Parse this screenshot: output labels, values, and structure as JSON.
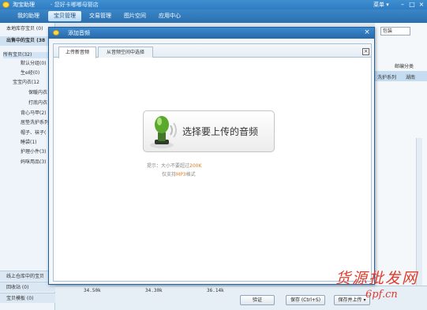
{
  "app": {
    "title": "淘宝助理",
    "shop": "- 您好卡嘟嘟母婴店",
    "user": "菜单 ▾",
    "window_buttons": [
      "–",
      "□",
      "×"
    ]
  },
  "nav": {
    "tabs": [
      {
        "label": "我的助理"
      },
      {
        "label": "宝贝管理"
      },
      {
        "label": "交易管理"
      },
      {
        "label": "图片空间"
      },
      {
        "label": "应用中心"
      }
    ]
  },
  "sidebar": {
    "header1": "本地库存宝贝 (0)",
    "header2": "出售中的宝贝 (38",
    "root": "所有宝贝(32)",
    "items": [
      {
        "label": "默认分组(0)"
      },
      {
        "label": "生e经(0)"
      },
      {
        "label": "宝宝内衣(12"
      },
      {
        "label": "保暖内衣"
      },
      {
        "label": "打底内衣"
      },
      {
        "label": "背心马甲(2)"
      },
      {
        "label": "居垫洗护系列"
      },
      {
        "label": "帽子、袜子("
      },
      {
        "label": "睡袋(1)"
      },
      {
        "label": "护理小件(3)"
      },
      {
        "label": "妈咪用品(3)"
      }
    ],
    "footer": [
      {
        "label": "线上仓库中的宝贝"
      },
      {
        "label": "回收站 (0)"
      },
      {
        "label": "宝贝模板 (0)"
      }
    ]
  },
  "background": {
    "search_text": "包装",
    "col_header": "邮编分类",
    "cell1": "洗护系列",
    "cell2": "湖南",
    "sizes": [
      "34.50k",
      "34.30k",
      "36.14k"
    ],
    "buttons": {
      "verify": "验证",
      "save": "保存 (Ctrl+S)",
      "save_upload": "保存并上传 ▾"
    }
  },
  "dialog": {
    "title": "添加音频",
    "close": "×",
    "tabs": [
      {
        "label": "上传新音频"
      },
      {
        "label": "从音频空间中选择"
      }
    ],
    "panel_close": "×",
    "upload_button": "选择要上传的音频",
    "hint": {
      "prefix": "提示：大小不要超过",
      "limit": "200K",
      "line2_prefix": "仅支持",
      "format": "MP3",
      "line2_suffix": "格式"
    }
  },
  "watermark": {
    "text": "货源批发网",
    "url": "6pf.cn"
  },
  "colors": {
    "titlebar": "#2f7cc2",
    "accent_orange": "#e67e22",
    "watermark": "#e23a2a",
    "mic_green": "#5aa92d"
  }
}
